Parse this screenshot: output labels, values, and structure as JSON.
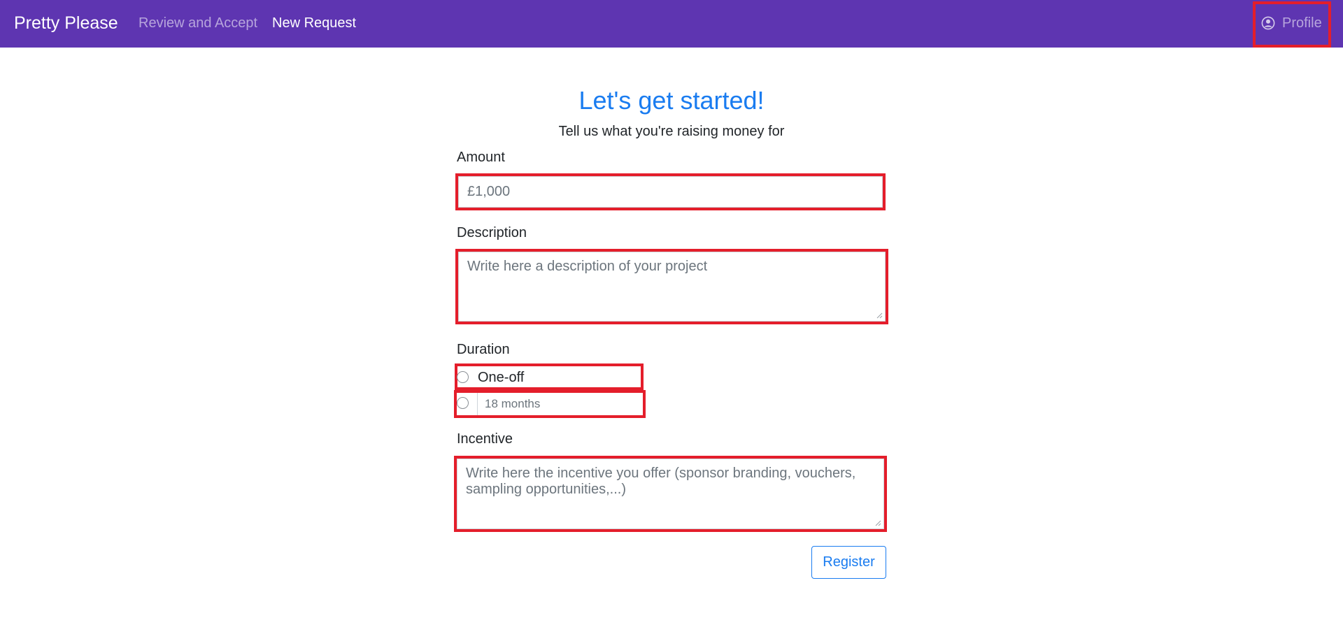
{
  "navbar": {
    "brand": "Pretty Please",
    "links": [
      {
        "label": "Review and Accept"
      },
      {
        "label": "New Request"
      }
    ],
    "profile": {
      "label": "Profile",
      "icon": "user-circle-icon"
    },
    "background": "#5e35b1"
  },
  "page": {
    "title": "Let's get started!",
    "subtitle": "Tell us what you're raising money for"
  },
  "form": {
    "amount": {
      "label": "Amount",
      "placeholder": "£1,000",
      "value": ""
    },
    "description": {
      "label": "Description",
      "placeholder": "Write here a description of your project",
      "value": ""
    },
    "duration": {
      "label": "Duration",
      "options": [
        {
          "label": "One-off",
          "selected": false
        },
        {
          "placeholder": "18 months",
          "selected": false
        }
      ]
    },
    "incentive": {
      "label": "Incentive",
      "placeholder": "Write here the incentive you offer (sponsor branding, vouchers, sampling opportunities,...)",
      "value": ""
    },
    "submit_label": "Register"
  },
  "colors": {
    "accent": "#1a7cf0",
    "highlight": "#e41e2b"
  }
}
